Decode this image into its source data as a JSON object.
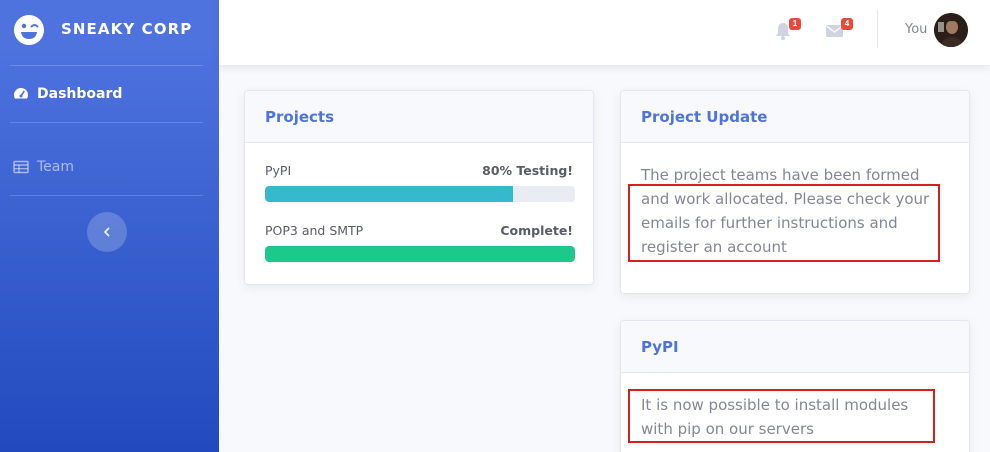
{
  "brand": {
    "name": "SNEAKY CORP",
    "logo_icon": "laugh-wink-icon"
  },
  "sidebar": {
    "items": [
      {
        "label": "Dashboard",
        "icon": "tachometer-icon",
        "active": true
      },
      {
        "label": "Team",
        "icon": "table-icon",
        "active": false
      }
    ],
    "toggle_icon": "chevron-left-icon"
  },
  "topbar": {
    "alerts": {
      "icon": "bell-icon",
      "count": "1"
    },
    "messages": {
      "icon": "envelope-icon",
      "count": "4"
    },
    "user": {
      "name": "You"
    }
  },
  "projects_card": {
    "title": "Projects",
    "items": [
      {
        "name": "PyPI",
        "status": "80% Testing!",
        "progress": 80,
        "color": "#36b9cc"
      },
      {
        "name": "POP3 and SMTP",
        "status": "Complete!",
        "progress": 100,
        "color": "#1cc88a"
      }
    ]
  },
  "update_card": {
    "title": "Project Update",
    "text": "The project teams have been formed and work allocated. Please check your emails for further instructions and register an account"
  },
  "pypi_card": {
    "title": "PyPI",
    "text": "It is now possible to install modules with pip on our servers"
  },
  "colors": {
    "primary": "#4e73df",
    "danger": "#e74a3b",
    "info": "#36b9cc",
    "success": "#1cc88a",
    "highlight": "#d42020"
  }
}
